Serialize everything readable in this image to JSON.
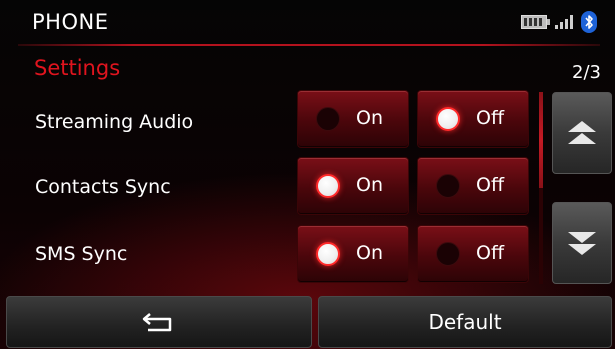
{
  "header": {
    "title": "PHONE",
    "battery_icon": "battery-icon",
    "signal_icon": "signal-strength-icon",
    "bluetooth_icon": "bluetooth-icon"
  },
  "section": {
    "title": "Settings",
    "page": "2/3"
  },
  "settings": [
    {
      "label": "Streaming Audio",
      "on_label": "On",
      "off_label": "Off",
      "selected": "Off"
    },
    {
      "label": "Contacts Sync",
      "on_label": "On",
      "off_label": "Off",
      "selected": "On"
    },
    {
      "label": "SMS Sync",
      "on_label": "On",
      "off_label": "Off",
      "selected": "On"
    }
  ],
  "scroll": {
    "up_icon": "scroll-up-icon",
    "down_icon": "scroll-down-icon"
  },
  "footer": {
    "back_icon": "back-arrow-icon",
    "default_label": "Default"
  },
  "colors": {
    "accent": "#e0141e",
    "knob_ring": "#ff2a2a",
    "toggle_bg": "#5a0a10"
  }
}
